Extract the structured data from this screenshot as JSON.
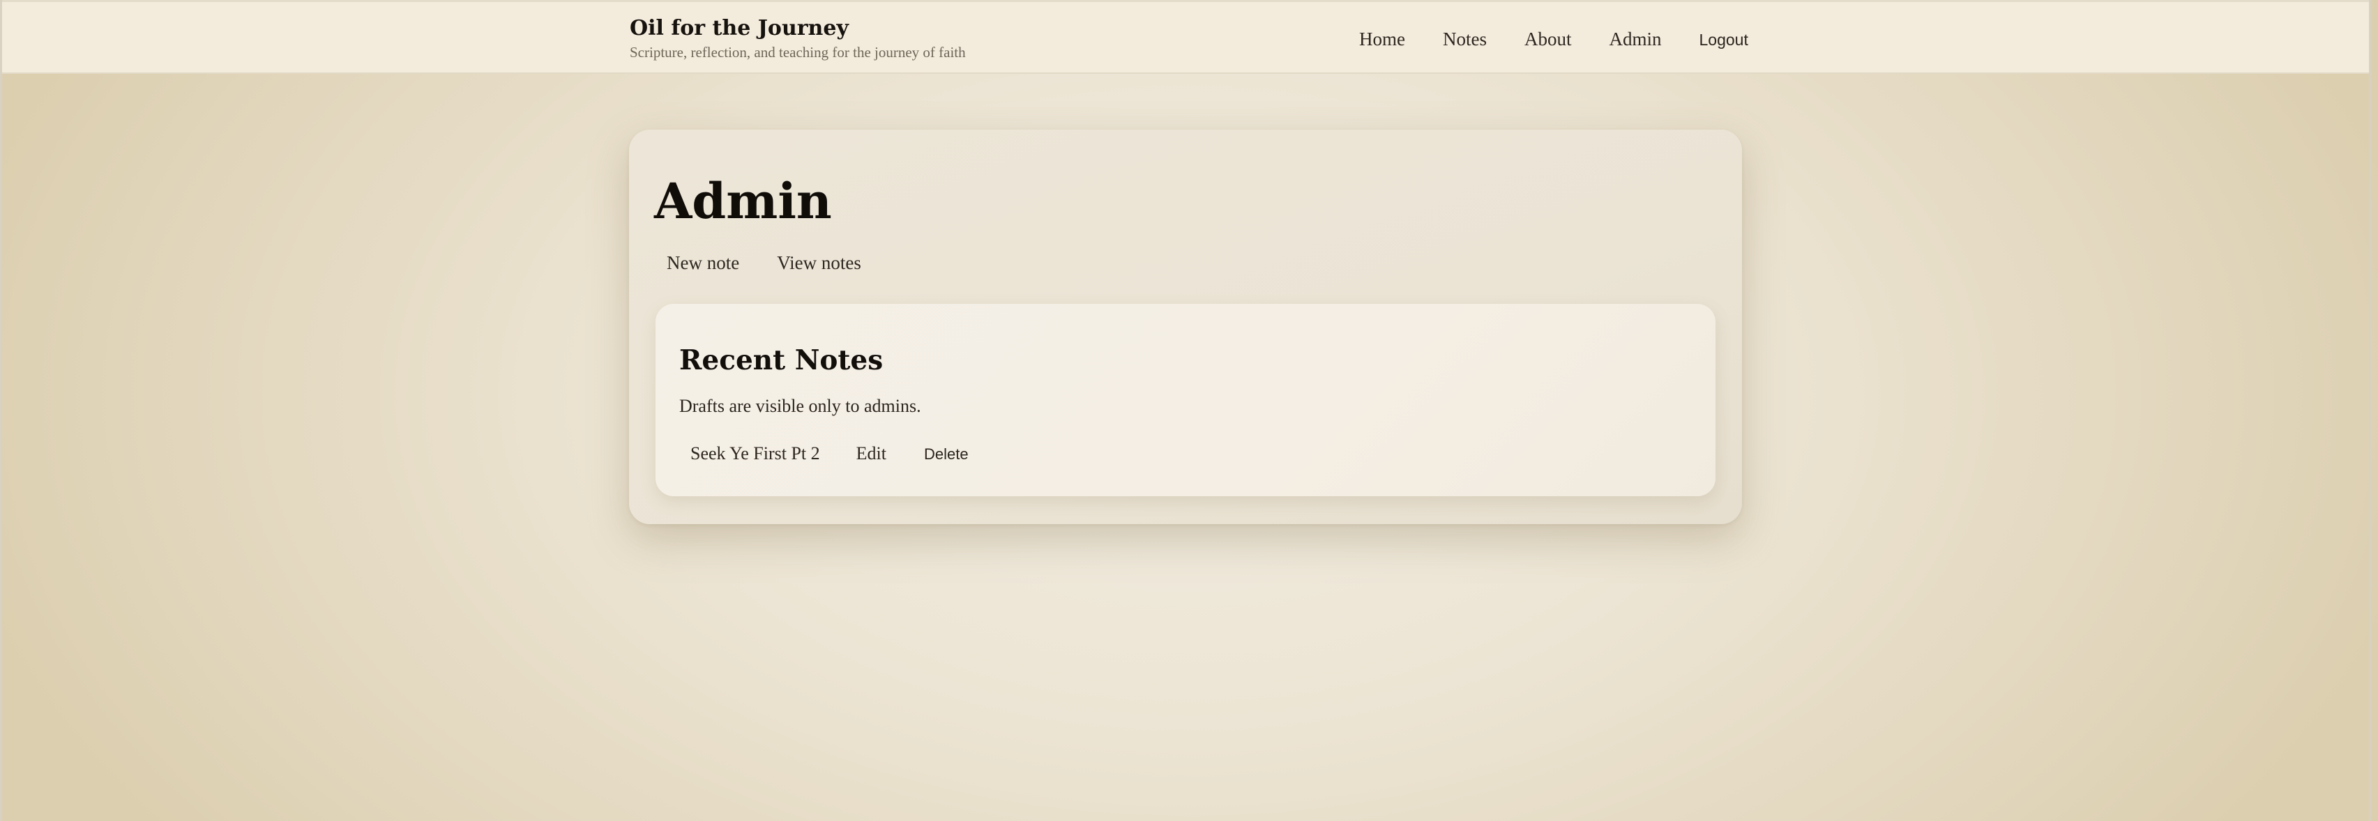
{
  "site": {
    "title": "Oil for the Journey",
    "tagline": "Scripture, reflection, and teaching for the journey of faith"
  },
  "nav": {
    "items": [
      {
        "label": "Home"
      },
      {
        "label": "Notes"
      },
      {
        "label": "About"
      },
      {
        "label": "Admin"
      }
    ],
    "logout_label": "Logout"
  },
  "admin": {
    "title": "Admin",
    "actions": [
      {
        "label": "New note"
      },
      {
        "label": "View notes"
      }
    ]
  },
  "recent_notes": {
    "title": "Recent Notes",
    "description": "Drafts are visible only to admins.",
    "items": [
      {
        "title": "Seek Ye First Pt 2",
        "edit_label": "Edit",
        "delete_label": "Delete"
      }
    ]
  },
  "colors": {
    "page_background": "#ece4d3",
    "header_background": "#f3ebdc",
    "card_background": "#ede6d8",
    "inner_card_background": "#f5f0e7",
    "text": "#1f1a14"
  }
}
